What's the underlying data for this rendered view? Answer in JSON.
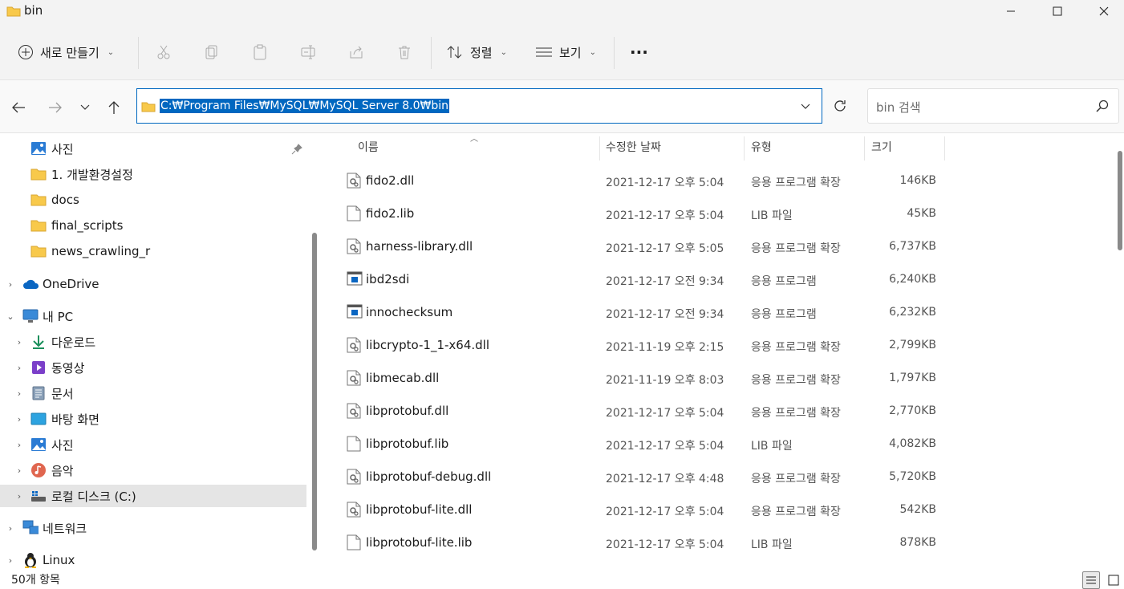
{
  "window": {
    "title": "bin"
  },
  "toolbar": {
    "new_label": "새로 만들기",
    "sort_label": "정렬",
    "view_label": "보기",
    "more_label": "···"
  },
  "address": {
    "path": "C:₩Program Files₩MySQL₩MySQL Server 8.0₩bin",
    "search_placeholder": "bin 검색"
  },
  "sidebar": {
    "items": [
      {
        "label": "사진",
        "icon": "photos-icon"
      },
      {
        "label": "1. 개발환경설정",
        "icon": "folder-icon"
      },
      {
        "label": "docs",
        "icon": "folder-icon"
      },
      {
        "label": "final_scripts",
        "icon": "folder-icon"
      },
      {
        "label": "news_crawling_r",
        "icon": "folder-icon"
      },
      {
        "label": "OneDrive",
        "icon": "onedrive-icon"
      },
      {
        "label": "내 PC",
        "icon": "pc-icon"
      },
      {
        "label": "다운로드",
        "icon": "download-icon"
      },
      {
        "label": "동영상",
        "icon": "videos-icon"
      },
      {
        "label": "문서",
        "icon": "documents-icon"
      },
      {
        "label": "바탕 화면",
        "icon": "desktop-icon"
      },
      {
        "label": "사진",
        "icon": "photos-icon"
      },
      {
        "label": "음악",
        "icon": "music-icon"
      },
      {
        "label": "로컬 디스크 (C:)",
        "icon": "drive-icon"
      },
      {
        "label": "네트워크",
        "icon": "network-icon"
      },
      {
        "label": "Linux",
        "icon": "linux-icon"
      }
    ]
  },
  "columns": {
    "name": "이름",
    "date": "수정한 날짜",
    "type": "유형",
    "size": "크기"
  },
  "files": [
    {
      "name": "fido2.dll",
      "date": "2021-12-17 오후 5:04",
      "type": "응용 프로그램 확장",
      "size": "146KB",
      "icon": "dll-icon"
    },
    {
      "name": "fido2.lib",
      "date": "2021-12-17 오후 5:04",
      "type": "LIB 파일",
      "size": "45KB",
      "icon": "file-icon"
    },
    {
      "name": "harness-library.dll",
      "date": "2021-12-17 오후 5:05",
      "type": "응용 프로그램 확장",
      "size": "6,737KB",
      "icon": "dll-icon"
    },
    {
      "name": "ibd2sdi",
      "date": "2021-12-17 오전 9:34",
      "type": "응용 프로그램",
      "size": "6,240KB",
      "icon": "exe-icon"
    },
    {
      "name": "innochecksum",
      "date": "2021-12-17 오전 9:34",
      "type": "응용 프로그램",
      "size": "6,232KB",
      "icon": "exe-icon"
    },
    {
      "name": "libcrypto-1_1-x64.dll",
      "date": "2021-11-19 오후 2:15",
      "type": "응용 프로그램 확장",
      "size": "2,799KB",
      "icon": "dll-icon"
    },
    {
      "name": "libmecab.dll",
      "date": "2021-11-19 오후 8:03",
      "type": "응용 프로그램 확장",
      "size": "1,797KB",
      "icon": "dll-icon"
    },
    {
      "name": "libprotobuf.dll",
      "date": "2021-12-17 오후 5:04",
      "type": "응용 프로그램 확장",
      "size": "2,770KB",
      "icon": "dll-icon"
    },
    {
      "name": "libprotobuf.lib",
      "date": "2021-12-17 오후 5:04",
      "type": "LIB 파일",
      "size": "4,082KB",
      "icon": "file-icon"
    },
    {
      "name": "libprotobuf-debug.dll",
      "date": "2021-12-17 오후 4:48",
      "type": "응용 프로그램 확장",
      "size": "5,720KB",
      "icon": "dll-icon"
    },
    {
      "name": "libprotobuf-lite.dll",
      "date": "2021-12-17 오후 5:04",
      "type": "응용 프로그램 확장",
      "size": "542KB",
      "icon": "dll-icon"
    },
    {
      "name": "libprotobuf-lite.lib",
      "date": "2021-12-17 오후 5:04",
      "type": "LIB 파일",
      "size": "878KB",
      "icon": "file-icon"
    }
  ],
  "status": {
    "count": "50개 항목"
  },
  "colors": {
    "accent": "#0067c0",
    "folder": "#f8c94b"
  }
}
